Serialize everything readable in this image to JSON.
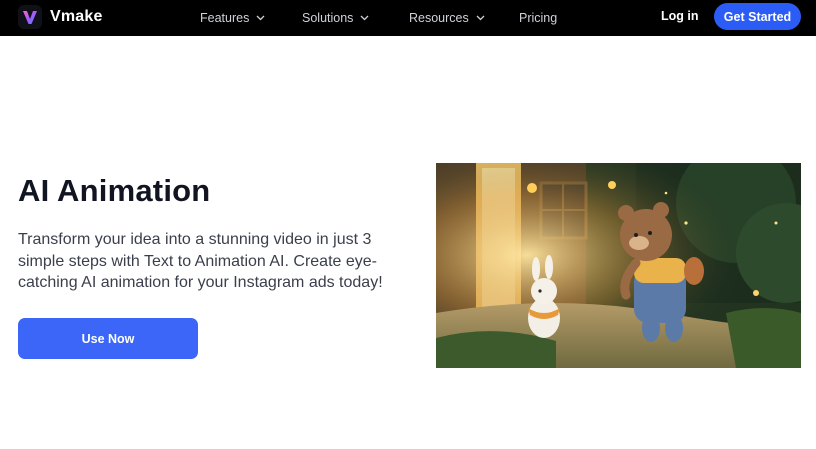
{
  "nav": {
    "brand": "Vmake",
    "items": [
      {
        "label": "Features",
        "dropdown": true
      },
      {
        "label": "Solutions",
        "dropdown": true
      },
      {
        "label": "Resources",
        "dropdown": true
      },
      {
        "label": "Pricing",
        "dropdown": false
      }
    ],
    "login_label": "Log in",
    "cta_label": "Get Started"
  },
  "hero": {
    "title": "AI Animation",
    "description": "Transform your idea into a stunning video in just 3 simple steps with Text to Animation AI. Create eye-catching AI animation for your Instagram ads today!",
    "button_label": "Use Now",
    "illustration_icons": [
      "bear-character",
      "bunny-character",
      "lantern-icon"
    ]
  },
  "colors": {
    "nav_bg": "#000000",
    "accent": "#2b5cf5",
    "button": "#3b66f7",
    "title": "#111522",
    "body_text": "#3a3f4b"
  }
}
